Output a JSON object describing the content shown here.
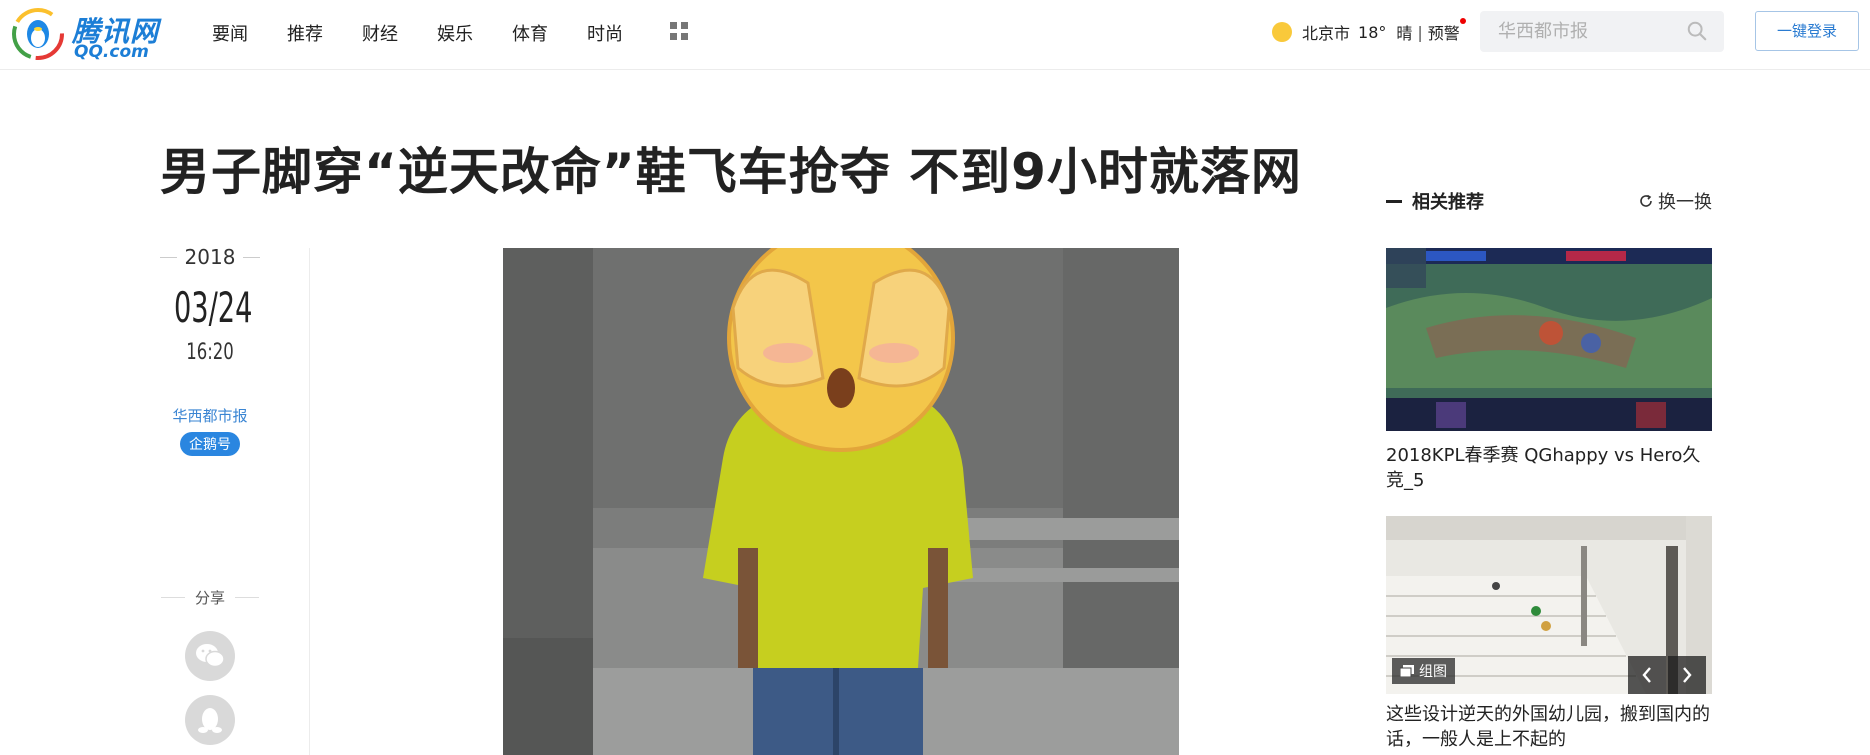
{
  "header": {
    "logo_text": "腾讯网",
    "logo_sub": "QQ.com",
    "nav": [
      "要闻",
      "推荐",
      "财经",
      "娱乐",
      "体育",
      "时尚"
    ],
    "apps_icon": "grid-icon",
    "weather": {
      "city": "北京市",
      "temp": "18°",
      "condition": "晴",
      "alert": "预警"
    },
    "search_placeholder": "华西都市报",
    "login_label": "一键登录"
  },
  "article": {
    "title": "男子脚穿“逆天改命”鞋飞车抢夺 不到9小时就落网",
    "year": "2018",
    "date": "03/24",
    "time": "16:20",
    "source": "华西都市报",
    "source_badge": "企鹅号",
    "share_label": "分享"
  },
  "related": {
    "title": "相关推荐",
    "refresh_label": "换一换",
    "items": [
      {
        "title": "2018KPL春季赛 QGhappy vs Hero久竞_5"
      },
      {
        "title": "这些设计逆天的外国幼儿园，搬到国内的话，一般人是上不起的",
        "tag": "组图"
      }
    ]
  },
  "colors": {
    "brand_blue": "#1c7ed6",
    "link_blue": "#3a85d3",
    "badge_blue": "#2a86e0"
  }
}
